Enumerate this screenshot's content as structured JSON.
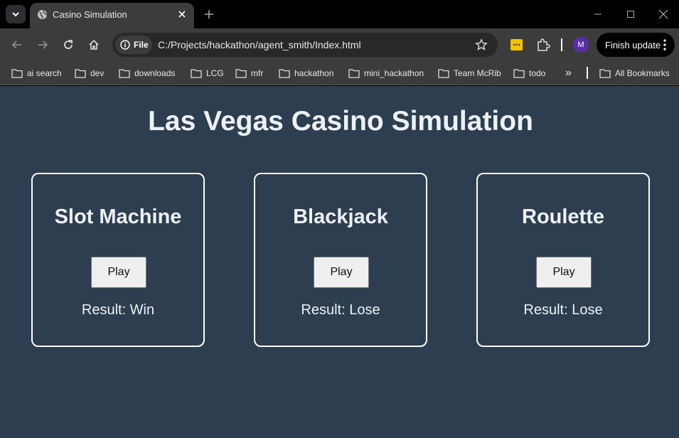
{
  "browser": {
    "tab": {
      "title": "Casino Simulation"
    },
    "omnibox": {
      "chip_label": "File",
      "url": "C:/Projects/hackathon/agent_smith/Index.html"
    },
    "profile_initial": "M",
    "finish_update_label": "Finish update",
    "bookmarks": [
      {
        "label": "ai search"
      },
      {
        "label": "dev"
      },
      {
        "label": "downloads"
      },
      {
        "label": "LCG"
      },
      {
        "label": "mfr"
      },
      {
        "label": "hackathon"
      },
      {
        "label": "mini_hackathon"
      },
      {
        "label": "Team McRib"
      },
      {
        "label": "todo"
      }
    ],
    "all_bookmarks_label": "All Bookmarks",
    "overflow_label": "»"
  },
  "page": {
    "title": "Las Vegas Casino Simulation",
    "games": [
      {
        "title": "Slot Machine",
        "button_label": "Play",
        "result": "Result: Win"
      },
      {
        "title": "Blackjack",
        "button_label": "Play",
        "result": "Result: Lose"
      },
      {
        "title": "Roulette",
        "button_label": "Play",
        "result": "Result: Lose"
      }
    ]
  },
  "colors": {
    "page_background": "#2d3e50",
    "card_border": "#ffffff",
    "browser_chrome": "#3c3c3c",
    "avatar": "#5a2ea6",
    "extension_yellow": "#f2c300"
  }
}
